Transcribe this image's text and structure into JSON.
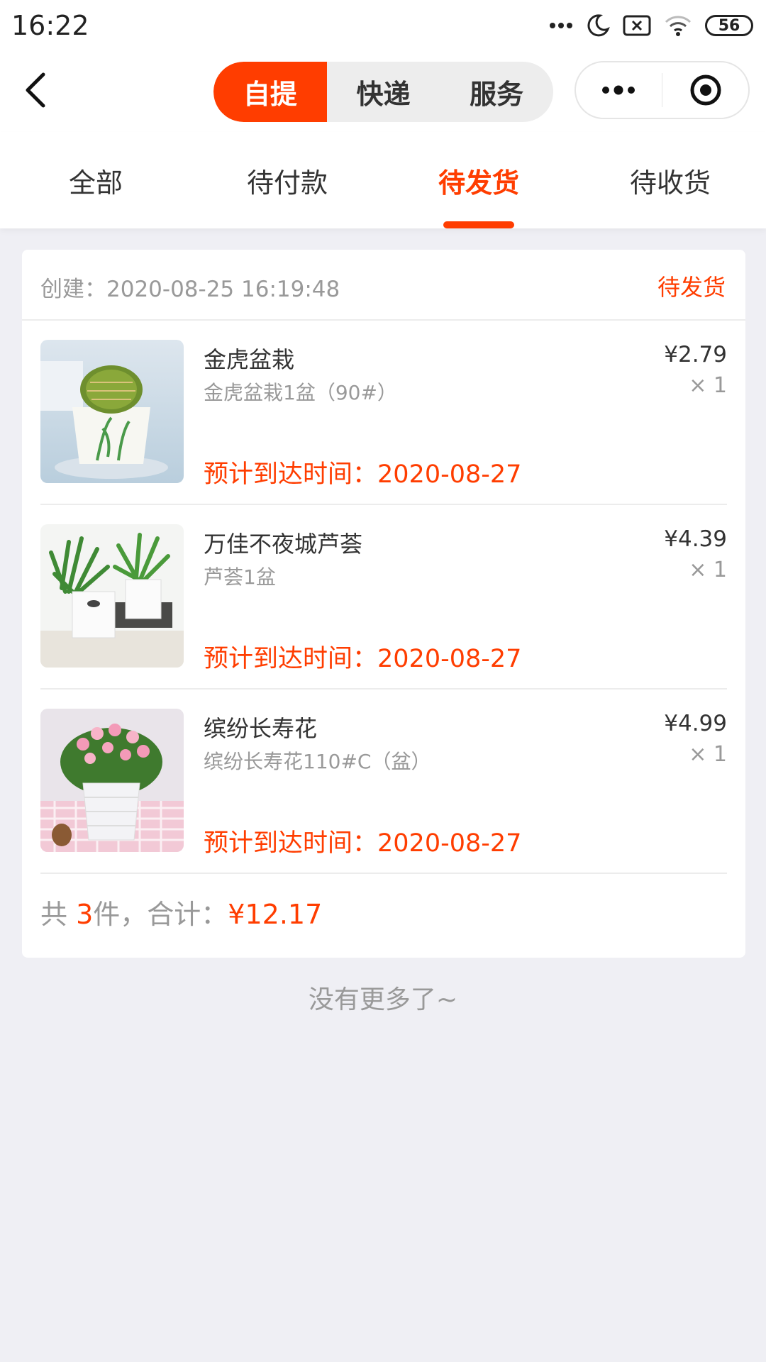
{
  "status_bar": {
    "time": "16:22",
    "battery": "56",
    "icons": [
      "more-dots-icon",
      "moon-icon",
      "close-box-icon",
      "wifi-icon",
      "battery-icon"
    ]
  },
  "nav": {
    "segments": [
      "自提",
      "快递",
      "服务"
    ],
    "active_segment": 0
  },
  "tabs": {
    "items": [
      "全部",
      "待付款",
      "待发货",
      "待收货"
    ],
    "active": 2
  },
  "order": {
    "created_label": "创建：",
    "created_time": "2020-08-25 16:19:48",
    "status": "待发货",
    "items": [
      {
        "name": "金虎盆栽",
        "spec": "金虎盆栽1盆（90#）",
        "price": "¥2.79",
        "qty": "× 1",
        "eta_label": "预计到达时间：",
        "eta": "2020-08-27"
      },
      {
        "name": "万佳不夜城芦荟",
        "spec": "芦荟1盆",
        "price": "¥4.39",
        "qty": "× 1",
        "eta_label": "预计到达时间：",
        "eta": "2020-08-27"
      },
      {
        "name": "缤纷长寿花",
        "spec": "缤纷长寿花110#C（盆）",
        "price": "¥4.99",
        "qty": "× 1",
        "eta_label": "预计到达时间：",
        "eta": "2020-08-27"
      }
    ],
    "summary": {
      "prefix": "共 ",
      "count": "3",
      "mid": "件，合计：",
      "total": "¥12.17"
    }
  },
  "footer": {
    "no_more": "没有更多了~"
  },
  "colors": {
    "accent": "#ff3d00",
    "background": "#efeff4"
  }
}
